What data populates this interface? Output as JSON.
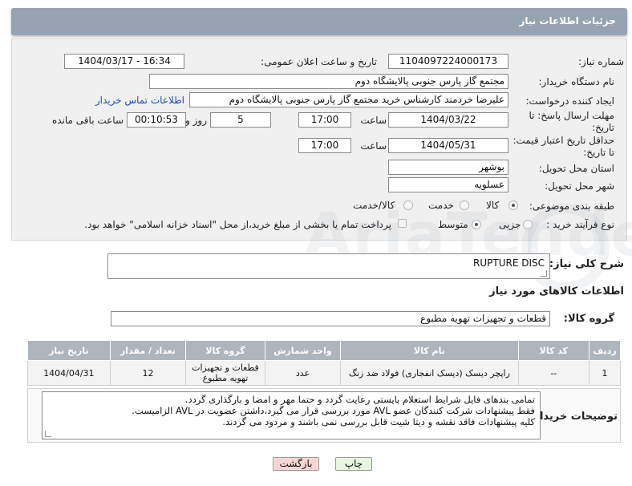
{
  "header": {
    "title": "جزئیات اطلاعات نیاز"
  },
  "form": {
    "need_number": {
      "label": "شماره نیاز:",
      "value": "1104097224000173"
    },
    "announce": {
      "label": "تاریخ و ساعت اعلان عمومی:",
      "value": "1404/03/17 - 16:34"
    },
    "buyer_org": {
      "label": "نام دستگاه خریدار:",
      "value": "مجتمع گاز پارس جنوبی  پالایشگاه دوم"
    },
    "requester": {
      "label": "ایجاد کننده درخواست:",
      "value": "علیرضا خردمند کارشناس خرید مجتمع گاز پارس جنوبی  پالایشگاه دوم",
      "contact_link": "اطلاعات تماس خریدار"
    },
    "reply_deadline": {
      "label": "مهلت ارسال پاسخ: تا تاریخ:",
      "date": "1404/03/22",
      "time_label": "ساعت",
      "time": "17:00",
      "days": "5",
      "days_label": "روز و",
      "remaining": "00:10:53",
      "remaining_label": "ساعت باقی مانده"
    },
    "price_validity": {
      "label": "حداقل تاریخ اعتبار قیمت: تا تاریخ:",
      "date": "1404/05/31",
      "time_label": "ساعت",
      "time": "17:00"
    },
    "province": {
      "label": "استان محل تحویل:",
      "value": "بوشهر"
    },
    "city": {
      "label": "شهر محل تحویل:",
      "value": "عسلویه"
    },
    "category": {
      "label": "طبقه بندی موضوعی:",
      "options": [
        "کالا",
        "خدمت",
        "کالا/خدمت"
      ],
      "selected": "کالا"
    },
    "process": {
      "label": "نوع فرآیند خرید :",
      "options": [
        "جزیی",
        "متوسط"
      ],
      "selected": "متوسط",
      "note": "پرداخت تمام یا بخشی از مبلغ خرید،از محل \"اسناد خزانه اسلامی\" خواهد بود."
    }
  },
  "description": {
    "label": "شرح کلی نیاز:",
    "value": "RUPTURE DISC"
  },
  "goods_section": {
    "title": "اطلاعات کالاهای مورد نیاز",
    "group_label": "گروه کالا:",
    "group_value": "قطعات و تجهیزات تهویه مطبوع"
  },
  "table": {
    "headers": [
      "ردیف",
      "کد کالا",
      "نام کالا",
      "واحد شمارش",
      "گروه کالا",
      "تعداد / مقدار",
      "تاریخ نیاز"
    ],
    "rows": [
      [
        "1",
        "--",
        "راپچر دیسک (دیسک انفجاری) فولاد ضد زنگ",
        "عدد",
        "قطعات و تجهیزات تهویه مطبوع",
        "12",
        "1404/04/31"
      ]
    ]
  },
  "buyer_notes": {
    "label": "توضیحات خریدار:",
    "lines": [
      "تمامی بندهای فایل شرایط استعلام بایستی رعایت گردد و حتما مهر و امضا و بارگذاری گردد.",
      "فقط پیشنهادات شرکت کنندگان عضو AVL مورد بررسی قرار می گیرد،داشتن عضویت در AVL الزامیست.",
      "کلیه پیشنهادات فاقد نقشه و دیتا شیت قابل بررسی نمی باشند و مردود می گردند."
    ]
  },
  "buttons": {
    "print": "چاپ",
    "back": "بازگشت"
  },
  "watermark": "AriaTender.net",
  "colors": {
    "header": "#96a3b1",
    "table_header": "#aeb5bd",
    "link": "#1a4fb5",
    "back_button": "#f9d6d6",
    "print_button": "#e8f5e0"
  }
}
